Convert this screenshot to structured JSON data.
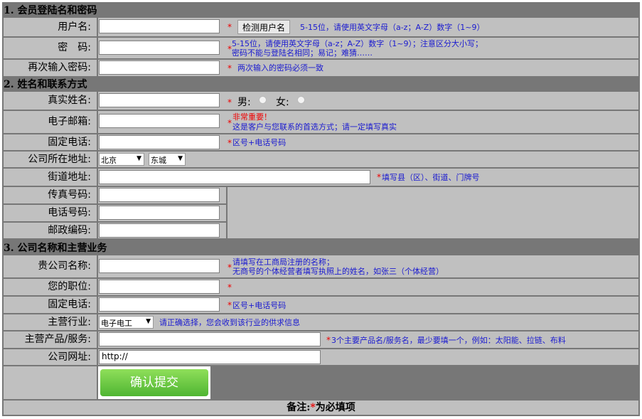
{
  "section1": {
    "title": "1. 会员登陆名和密码"
  },
  "username": {
    "label": "用户名:",
    "check_btn": "检测用户名",
    "hint": "5-15位，请使用英文字母（a-z；A-Z）数字（1~9）"
  },
  "password": {
    "label": "密　码:",
    "hint1": "5-15位，请使用英文字母（a-z；A-Z）数字（1~9）；注意区分大小写；",
    "hint2": "密码不能与登陆名相同；易记；难猜……"
  },
  "password2": {
    "label": "再次输入密码:",
    "hint": "两次输入的密码必须一致"
  },
  "section2": {
    "title": "2. 姓名和联系方式"
  },
  "realname": {
    "label": "真实姓名:",
    "male": "男:",
    "female": "女:"
  },
  "email": {
    "label": "电子邮箱:",
    "hint_red": "非常重要！",
    "hint": "这是客户与您联系的首选方式；请一定填写真实"
  },
  "phone": {
    "label": "固定电话:",
    "hint": "区号+电话号码"
  },
  "region": {
    "label": "公司所在地址:",
    "city": "北京",
    "district": "东城"
  },
  "street": {
    "label": "街道地址:",
    "hint": "填写县（区）、街道、门牌号"
  },
  "fax": {
    "label": "传真号码:"
  },
  "tel": {
    "label": "电话号码:"
  },
  "zip": {
    "label": "邮政编码:"
  },
  "section3": {
    "title": "3. 公司名称和主营业务"
  },
  "company": {
    "label": "贵公司名称:",
    "hint1": "请填写在工商局注册的名称；",
    "hint2": "无商号的个体经营者填写执照上的姓名，如张三（个体经营）"
  },
  "position": {
    "label": "您的职位:"
  },
  "phone2": {
    "label": "固定电话:",
    "hint": "区号+电话号码"
  },
  "industry": {
    "label": "主营行业:",
    "value": "电子电工",
    "hint": "请正确选择，您会收到该行业的供求信息"
  },
  "products": {
    "label": "主营产品/服务:",
    "hint": "3个主要产品名/服务名，最少要填一个，例如：太阳能、拉链、布料"
  },
  "website": {
    "label": "公司网址:",
    "value": "http://"
  },
  "submit": {
    "label": "确认提交"
  },
  "footer": {
    "prefix": "备注:",
    "star": "*",
    "suffix": "为必填项"
  },
  "required_mark": "*"
}
